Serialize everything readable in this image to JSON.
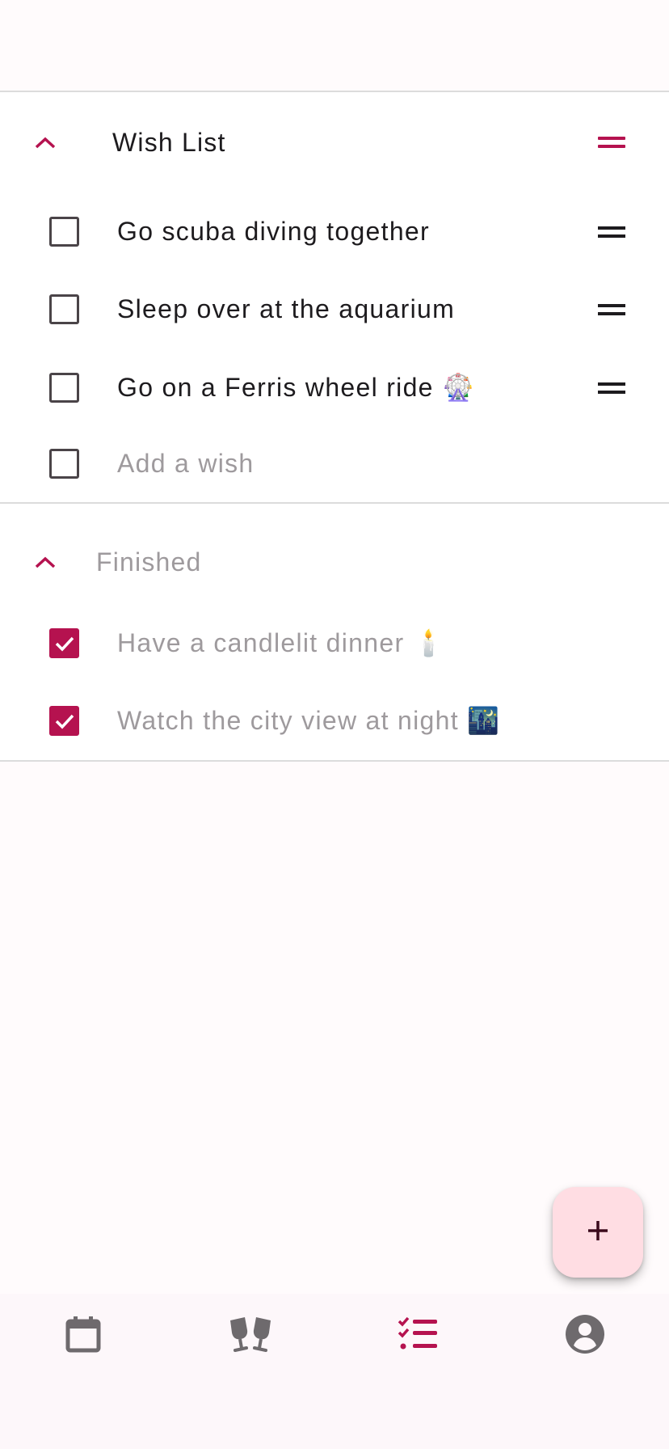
{
  "wish_section": {
    "title": "Wish List",
    "items": [
      {
        "label": "Go scuba diving together",
        "checked": false
      },
      {
        "label": "Sleep over at the aquarium",
        "checked": false
      },
      {
        "label": "Go on a Ferris wheel ride 🎡",
        "checked": false
      }
    ],
    "add_placeholder": "Add a wish"
  },
  "finished_section": {
    "title": "Finished",
    "items": [
      {
        "label": "Have a candlelit dinner 🕯️",
        "checked": true
      },
      {
        "label": "Watch the city view at night 🌃",
        "checked": true
      }
    ]
  },
  "fab": {
    "icon": "plus-icon"
  },
  "bottom_nav": {
    "items": [
      {
        "icon": "calendar-icon",
        "active": false
      },
      {
        "icon": "cheers-icon",
        "active": false
      },
      {
        "icon": "checklist-icon",
        "active": true
      },
      {
        "icon": "account-circle-icon",
        "active": false
      }
    ]
  },
  "colors": {
    "accent": "#b5124f",
    "icon_inactive": "#6e6a6d",
    "text_muted": "#9e9a9d",
    "fab_background": "#ffdde3"
  }
}
